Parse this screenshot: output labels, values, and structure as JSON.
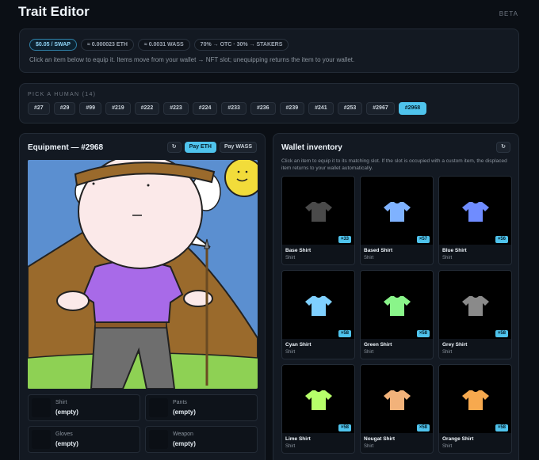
{
  "header": {
    "title": "Trait Editor",
    "badge": "BETA"
  },
  "info": {
    "pills": [
      "$0.05 / SWAP",
      "≈ 0.000023 ETH",
      "≈ 0.0031 WASS",
      "70% → OTC · 30% → STAKERS"
    ],
    "text": "Click an item below to equip it. Items move from your wallet → NFT slot; unequipping returns the item to your wallet."
  },
  "picker": {
    "label": "PICK A HUMAN (14)",
    "ids": [
      "#27",
      "#29",
      "#99",
      "#219",
      "#222",
      "#223",
      "#224",
      "#233",
      "#236",
      "#239",
      "#241",
      "#253",
      "#2967",
      "#2968"
    ],
    "selected": "#2968"
  },
  "equipment": {
    "title": "Equipment — #2968",
    "refresh_icon": "↻",
    "pay_eth": "Pay ETH",
    "pay_wass": "Pay WASS",
    "slots": [
      {
        "name": "Shirt",
        "value": "(empty)"
      },
      {
        "name": "Pants",
        "value": "(empty)"
      },
      {
        "name": "Gloves",
        "value": "(empty)"
      },
      {
        "name": "Weapon",
        "value": "(empty)"
      }
    ]
  },
  "wallet": {
    "title": "Wallet inventory",
    "refresh_icon": "↻",
    "description": "Click an item to equip it to its matching slot. If the slot is occupied with a custom item, the displaced item returns to your wallet automatically.",
    "items": [
      {
        "name": "Base Shirt",
        "type": "Shirt",
        "count": "×33",
        "color": "#4a4a4a"
      },
      {
        "name": "Based Shirt",
        "type": "Shirt",
        "count": "×57",
        "color": "#7fb2ff"
      },
      {
        "name": "Blue Shirt",
        "type": "Shirt",
        "count": "×56",
        "color": "#6f8cff"
      },
      {
        "name": "Cyan Shirt",
        "type": "Shirt",
        "count": "×58",
        "color": "#7fd0ff"
      },
      {
        "name": "Green Shirt",
        "type": "Shirt",
        "count": "×58",
        "color": "#8af58a"
      },
      {
        "name": "Grey Shirt",
        "type": "Shirt",
        "count": "×58",
        "color": "#8a8a8a"
      },
      {
        "name": "Lime Shirt",
        "type": "Shirt",
        "count": "×58",
        "color": "#b6ff6a"
      },
      {
        "name": "Nougat Shirt",
        "type": "Shirt",
        "count": "×58",
        "color": "#f2b27a"
      },
      {
        "name": "Orange Shirt",
        "type": "Shirt",
        "count": "×58",
        "color": "#f7a94e"
      }
    ]
  }
}
